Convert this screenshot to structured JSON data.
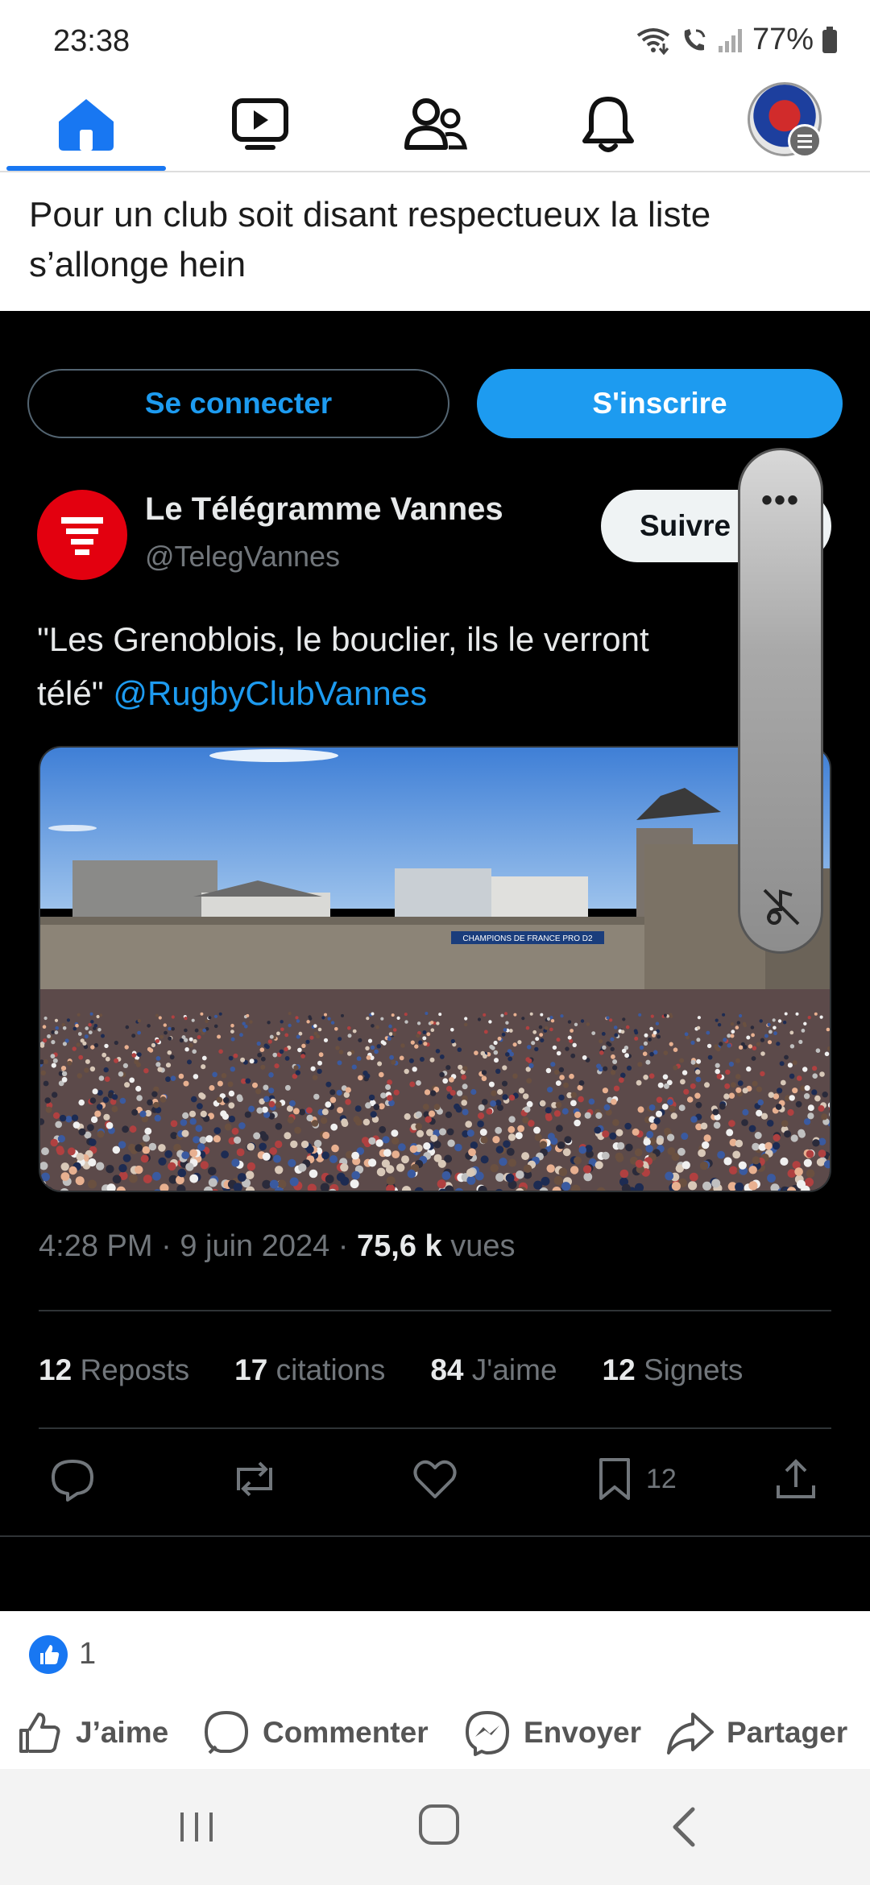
{
  "status_bar": {
    "time": "23:38",
    "battery": "77%",
    "icons": [
      "wifi-call-icon",
      "wifi-calling-phone-icon",
      "signal-icon",
      "battery-icon"
    ]
  },
  "fb_nav": {
    "items": [
      {
        "name": "home",
        "icon": "home-icon",
        "active": true
      },
      {
        "name": "video",
        "icon": "video-icon",
        "active": false
      },
      {
        "name": "friends",
        "icon": "friends-icon",
        "active": false
      },
      {
        "name": "notifications",
        "icon": "bell-icon",
        "active": false
      },
      {
        "name": "profile-menu",
        "icon": "avatar",
        "active": false
      }
    ],
    "accent": "#1877f2"
  },
  "post": {
    "text": "Pour un club soit disant respectueux la liste s’allonge hein"
  },
  "tweet": {
    "login_label": "Se connecter",
    "signup_label": "S'inscrire",
    "author_name": "Le Télégramme Vannes",
    "author_handle": "@TelegVannes",
    "follow_label": "Suivre",
    "text_main": "\"Les Grenoblois, le bouclier, ils le verront",
    "text_line2": "télé\"",
    "mention": "@RugbyClubVannes",
    "banner_text": "CHAMPIONS DE FRANCE PRO D2",
    "time": "4:28 PM",
    "date": "9 juin 2024",
    "views_count": "75,6 k",
    "views_label": "vues",
    "stats": [
      {
        "count": "12",
        "label": "Reposts"
      },
      {
        "count": "17",
        "label": "citations"
      },
      {
        "count": "84",
        "label": "J'aime"
      },
      {
        "count": "12",
        "label": "Signets"
      }
    ],
    "bookmark_count": "12",
    "colors": {
      "link": "#1d9bf0",
      "background": "#000000"
    }
  },
  "floating_pill": {
    "menu_label": "•••"
  },
  "reactions": {
    "count": "1"
  },
  "fb_actions": {
    "like": "J’aime",
    "comment": "Commenter",
    "send": "Envoyer",
    "share": "Partager"
  }
}
